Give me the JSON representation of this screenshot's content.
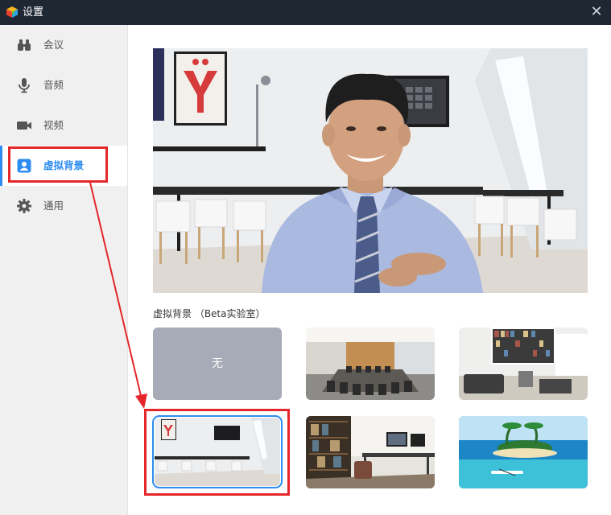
{
  "window": {
    "title": "设置",
    "close_glyph": "✕"
  },
  "sidebar": {
    "items": [
      {
        "label": "会议",
        "icon": "binoculars-icon"
      },
      {
        "label": "音频",
        "icon": "microphone-icon"
      },
      {
        "label": "视频",
        "icon": "video-camera-icon"
      },
      {
        "label": "虚拟背景",
        "icon": "person-card-icon",
        "active": true
      },
      {
        "label": "通用",
        "icon": "gear-icon"
      }
    ]
  },
  "virtual_background": {
    "section_label": "虚拟背景 （Beta实验室）",
    "none_label": "无",
    "selected_index": 3,
    "thumbnails": [
      "none",
      "conference-room",
      "living-room-bookshelf",
      "office-with-poster",
      "home-office-desk",
      "tropical-island"
    ]
  },
  "colors": {
    "accent": "#2d8cf0",
    "highlight": "#e5262a",
    "titlebar": "#1f2733",
    "sidebar": "#f0f0f0"
  }
}
